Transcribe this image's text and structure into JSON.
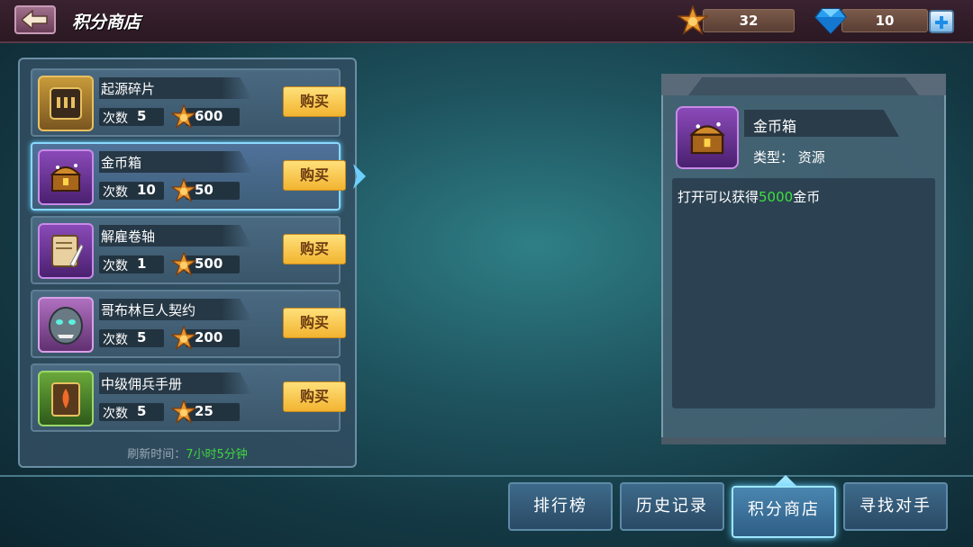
{
  "header": {
    "title": "积分商店",
    "points": "32",
    "diamonds": "10"
  },
  "shop": {
    "buy_label": "购买",
    "count_label": "次数",
    "items": [
      {
        "name": "起源碎片",
        "count": "5",
        "price": "600",
        "icon": "origin-fragment-icon"
      },
      {
        "name": "金币箱",
        "count": "10",
        "price": "50",
        "icon": "gold-chest-icon"
      },
      {
        "name": "解雇卷轴",
        "count": "1",
        "price": "500",
        "icon": "dismissal-scroll-icon"
      },
      {
        "name": "哥布林巨人契约",
        "count": "5",
        "price": "200",
        "icon": "goblin-giant-contract-icon"
      },
      {
        "name": "中级佣兵手册",
        "count": "5",
        "price": "25",
        "icon": "mercenary-manual-icon"
      }
    ],
    "refresh_label": "刷新时间：",
    "refresh_time": "7小时5分钟"
  },
  "detail": {
    "name": "金币箱",
    "type_label": "类型：",
    "type_value": "资源",
    "desc_prefix": "打开可以获得",
    "desc_highlight": "5000",
    "desc_suffix": "金币"
  },
  "tabs": [
    {
      "label": "排行榜"
    },
    {
      "label": "历史记录"
    },
    {
      "label": "积分商店"
    },
    {
      "label": "寻找对手"
    }
  ],
  "colors": {
    "accent_green": "#3ee03e",
    "buy_yellow": "#f2b430",
    "selected_glow": "#8ad8ff"
  }
}
